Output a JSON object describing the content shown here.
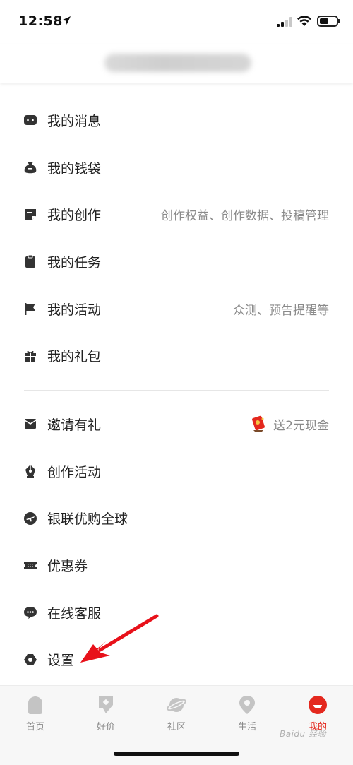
{
  "status_bar": {
    "time": "12:58",
    "battery_level": 0.55,
    "signal_bars": 2
  },
  "header": {
    "account_text": ""
  },
  "menu": {
    "group1": [
      {
        "label": "我的消息",
        "extra": "",
        "icon": "message-icon"
      },
      {
        "label": "我的钱袋",
        "extra": "",
        "icon": "money-bag-icon"
      },
      {
        "label": "我的创作",
        "extra": "创作权益、创作数据、投稿管理",
        "icon": "note-icon"
      },
      {
        "label": "我的任务",
        "extra": "",
        "icon": "clipboard-icon"
      },
      {
        "label": "我的活动",
        "extra": "众测、预告提醒等",
        "icon": "flag-icon"
      },
      {
        "label": "我的礼包",
        "extra": "",
        "icon": "gift-box-icon"
      }
    ],
    "group2": [
      {
        "label": "邀请有礼",
        "extra": "送2元现金",
        "icon": "envelope-icon"
      },
      {
        "label": "创作活动",
        "extra": "",
        "icon": "pen-nib-icon"
      },
      {
        "label": "银联优购全球",
        "extra": "",
        "icon": "plane-icon"
      },
      {
        "label": "优惠券",
        "extra": "",
        "icon": "ticket-icon"
      },
      {
        "label": "在线客服",
        "extra": "",
        "icon": "chat-icon"
      },
      {
        "label": "设置",
        "extra": "",
        "icon": "settings-icon"
      }
    ]
  },
  "tabbar": {
    "tabs": [
      {
        "label": "首页",
        "icon": "home-icon",
        "active": false
      },
      {
        "label": "好价",
        "icon": "price-tag-icon",
        "active": false
      },
      {
        "label": "社区",
        "icon": "planet-icon",
        "active": false
      },
      {
        "label": "生活",
        "icon": "location-pin-icon",
        "active": false
      },
      {
        "label": "我的",
        "icon": "profile-face-icon",
        "active": true
      }
    ]
  },
  "colors": {
    "accent": "#e4281e",
    "icon": "#333333",
    "muted": "#8a8a8a",
    "tab_inactive": "#c4c4c4"
  },
  "watermark": "Baidu 经验"
}
